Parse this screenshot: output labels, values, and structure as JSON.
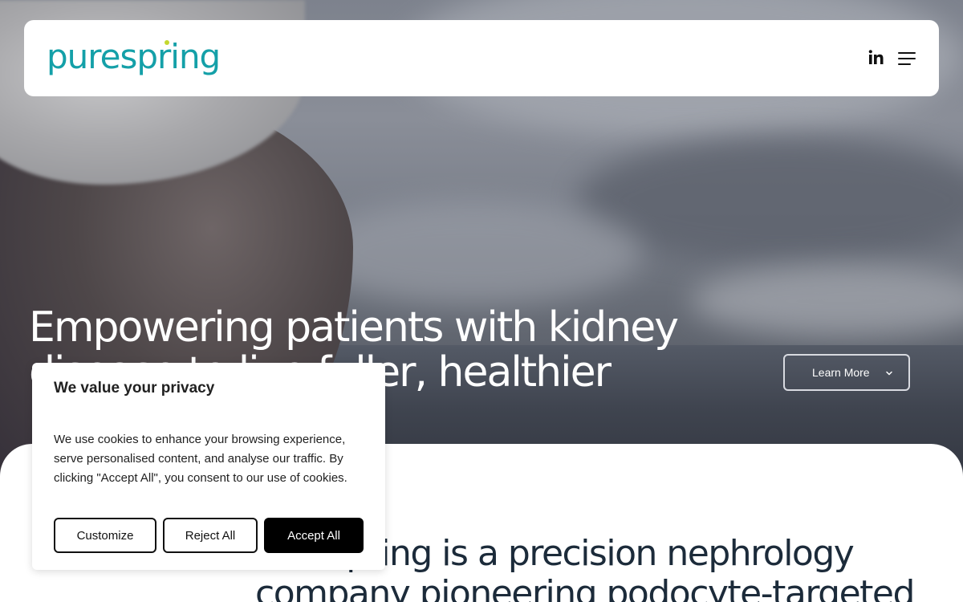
{
  "header": {
    "logo_text": "purespring",
    "linkedin_icon": "linkedin-icon",
    "menu_icon": "hamburger-menu-icon"
  },
  "hero": {
    "headline_line1": "Empowering patients with kidney",
    "headline_line2": "disease to live fuller, healthier lives",
    "headline_period": ".",
    "learn_more_label": "Learn More",
    "learn_more_icon": "chevron-down-icon"
  },
  "intro": {
    "statement_line1": "Purespring is a precision nephrology",
    "statement_line2": "company pioneering podocyte-targeted"
  },
  "cookie_banner": {
    "title": "We value your privacy",
    "body": "We use cookies to enhance your browsing experience, serve personalised content, and analyse our traffic. By clicking \"Accept All\", you consent to our use of cookies.",
    "customize_label": "Customize",
    "reject_label": "Reject All",
    "accept_label": "Accept All"
  },
  "colors": {
    "brand_teal": "#14a0a8",
    "accent_lime": "#d7e24a",
    "navy_text": "#1c2b3a"
  }
}
